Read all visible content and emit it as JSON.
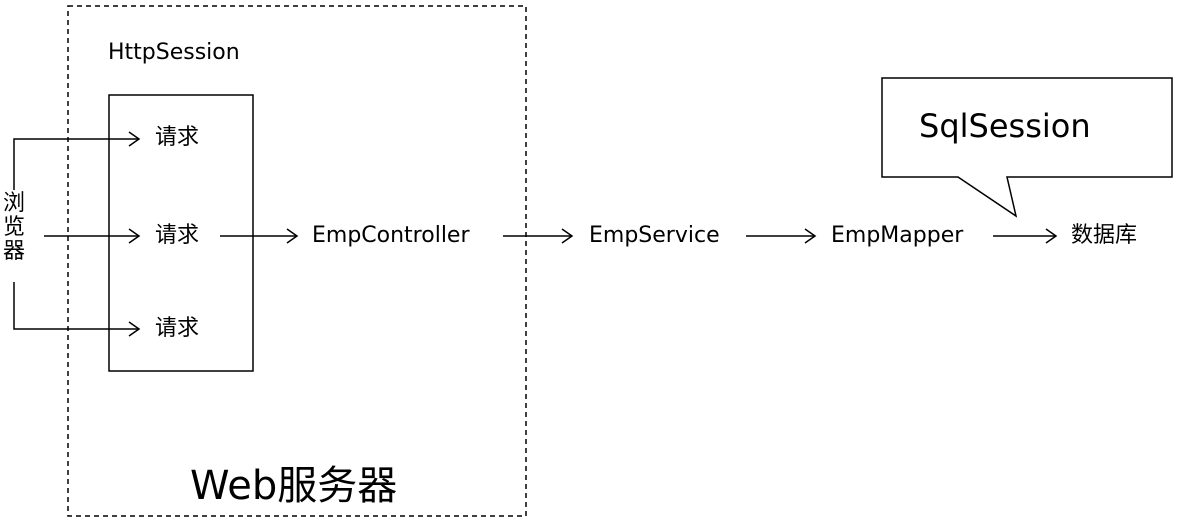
{
  "browser": {
    "chars": [
      "浏",
      "览",
      "器"
    ]
  },
  "web_server": {
    "label": "Web服务器"
  },
  "http_session": {
    "label": "HttpSession"
  },
  "requests": [
    "请求",
    "请求",
    "请求"
  ],
  "chain": {
    "controller": "EmpController",
    "service": "EmpService",
    "mapper": "EmpMapper",
    "database": "数据库"
  },
  "sql_session": {
    "label": "SqlSession"
  },
  "colors": {
    "line": "#000000",
    "background": "#ffffff"
  }
}
